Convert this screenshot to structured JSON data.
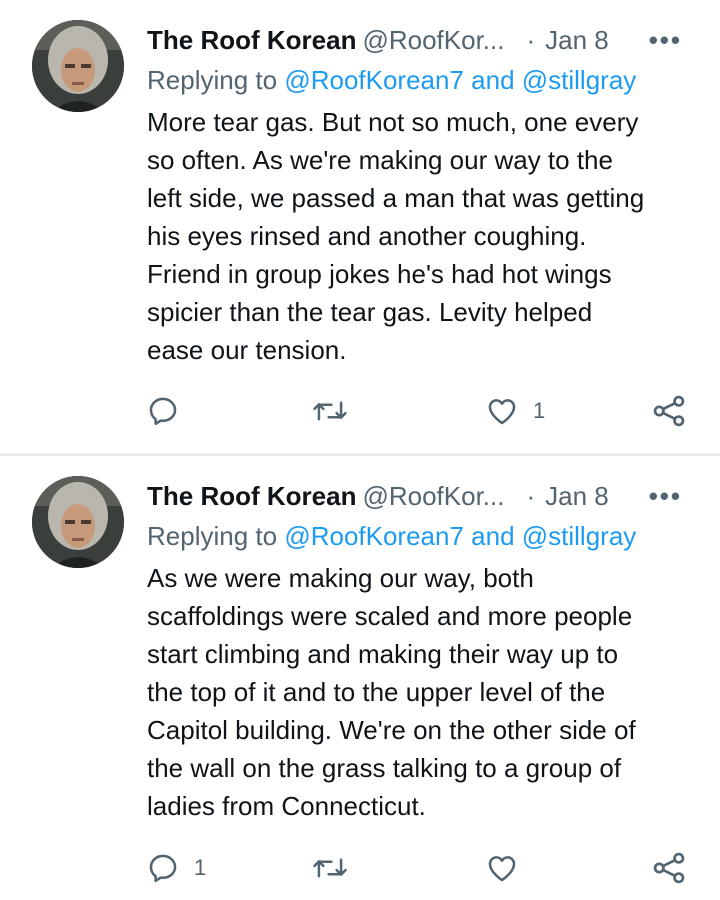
{
  "tweets": [
    {
      "author_name": "The Roof Korean",
      "author_handle": "@RoofKor...",
      "separator": "·",
      "date": "Jan 8",
      "more_label": "•••",
      "replying_prefix": "Replying to ",
      "replying_mention_1": "@RoofKorean7",
      "replying_and": " and ",
      "replying_mention_2": "@stillgray",
      "body_lines": [
        "More tear gas. But not so much, one every",
        "so often. As we're making our way to the",
        "left side, we passed a man that was getting",
        "his eyes rinsed and another coughing.",
        "Friend in group jokes he's had hot wings",
        "spicier than the tear gas. Levity helped",
        "ease our tension."
      ],
      "reply_count": "",
      "retweet_count": "",
      "like_count": "1"
    },
    {
      "author_name": "The Roof Korean",
      "author_handle": "@RoofKor...",
      "separator": "·",
      "date": "Jan 8",
      "more_label": "•••",
      "replying_prefix": "Replying to ",
      "replying_mention_1": "@RoofKorean7",
      "replying_and": " and ",
      "replying_mention_2": "@stillgray",
      "body_lines": [
        "As we were making our way, both",
        "scaffoldings were scaled and more people",
        "start climbing and making their way up to",
        "the top of it and to the upper level of the",
        "Capitol building. We're on the other side of",
        "the wall on the grass talking to a group of",
        "ladies from Connecticut."
      ],
      "reply_count": "1",
      "retweet_count": "",
      "like_count": ""
    }
  ],
  "icons": {
    "reply": "reply-icon",
    "retweet": "retweet-icon",
    "like": "like-icon",
    "share": "share-icon",
    "more": "more-icon"
  },
  "colors": {
    "text_primary": "#0f1419",
    "text_secondary": "#536471",
    "mention": "#1d9bf0",
    "divider": "#e6ecf0"
  }
}
